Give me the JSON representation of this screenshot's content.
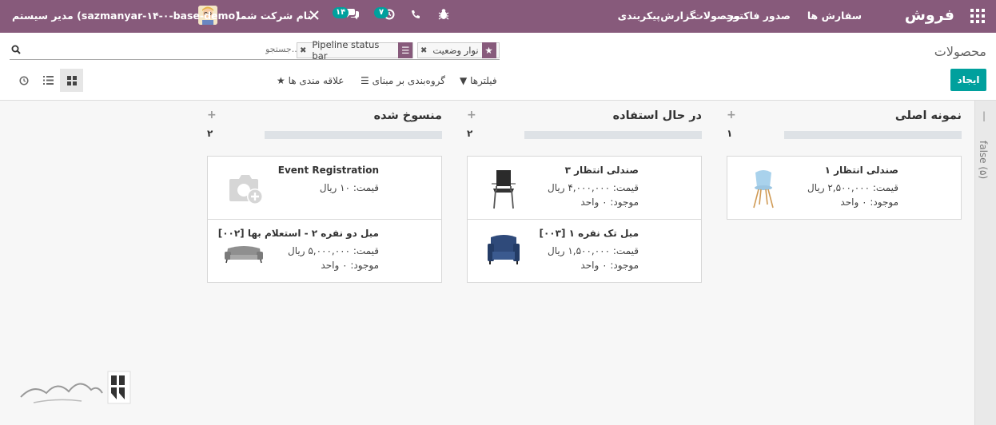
{
  "navbar": {
    "brand": "فروش",
    "menu": [
      "سفارش ها",
      "صدور فاکتور",
      "محصولات",
      "گزارش",
      "پیکربندی"
    ],
    "messages_badge": "۱۴",
    "activities_badge": "۷",
    "company": "نام شرکت شما",
    "user": "مدیر سیستم (sazmanyar-۱۴-۰-base-demo)"
  },
  "control": {
    "title": "محصولات",
    "search_placeholder": "جستجو...",
    "facets": [
      {
        "icon": "star-icon",
        "value": "نوار وضعیت"
      },
      {
        "icon": "group-icon",
        "value": "Pipeline status bar"
      }
    ],
    "create_label": "ایجاد",
    "filters_label": "فیلترها",
    "groupby_label": "گروه‌بندی بر مبنای",
    "favorites_label": "علاقه مندی ها"
  },
  "kanban": {
    "folded_column": "false (۵)",
    "columns": [
      {
        "title": "نمونه اصلی",
        "count": "۱",
        "cards": [
          {
            "name": "صندلی انتظار ۱",
            "price": "قیمت: ۲,۵۰۰,۰۰۰ ریال",
            "stock": "موجود: ۰ واحد",
            "image": "chair-blue-image"
          }
        ]
      },
      {
        "title": "در حال استفاده",
        "count": "۲",
        "cards": [
          {
            "name": "صندلی انتظار ۳",
            "price": "قیمت: ۴,۰۰۰,۰۰۰ ریال",
            "stock": "موجود: ۰ واحد",
            "image": "chair-black-image"
          },
          {
            "name": "مبل تک نفره ۱ [۰۰۳]",
            "price": "قیمت: ۱,۵۰۰,۰۰۰ ریال",
            "stock": "موجود: ۰ واحد",
            "image": "armchair-image"
          }
        ]
      },
      {
        "title": "منسوخ شده",
        "count": "۲",
        "cards": [
          {
            "name": "Event Registration",
            "price": "قیمت: ۱۰ ریال",
            "stock": "",
            "image": "placeholder-camera-image"
          },
          {
            "name": "مبل دو نفره ۲ - استعلام بها [۰۰۲]",
            "price": "قیمت: ۵,۰۰۰,۰۰۰ ریال",
            "stock": "موجود: ۰ واحد",
            "image": "sofa-image"
          }
        ]
      }
    ]
  },
  "colors": {
    "primary": "#875a7b",
    "accent": "#00a09d"
  }
}
